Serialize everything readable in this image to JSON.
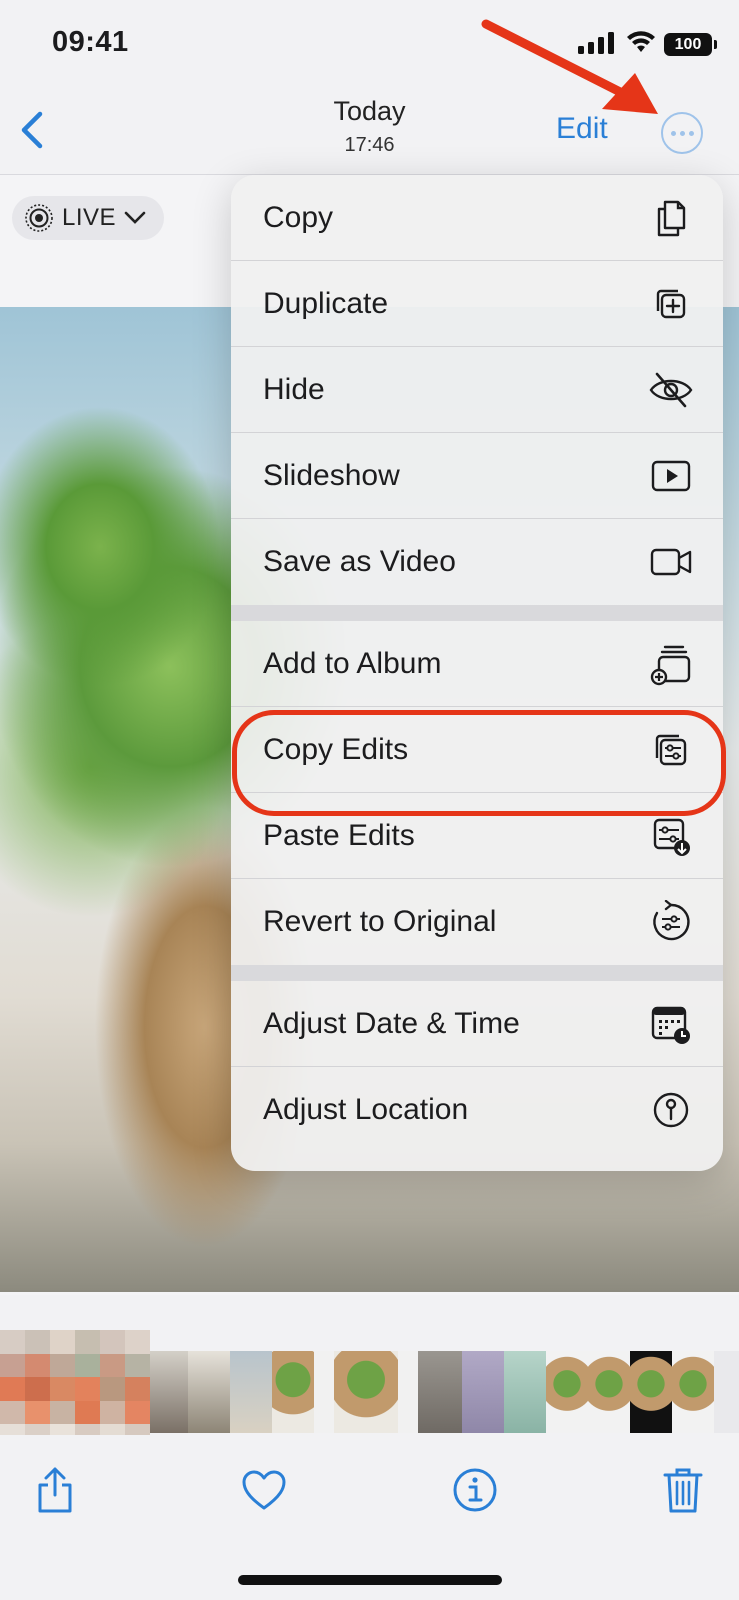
{
  "status_bar": {
    "time": "09:41",
    "battery": "100"
  },
  "nav": {
    "title": "Today",
    "subtitle": "17:46",
    "edit_label": "Edit"
  },
  "live_badge": {
    "label": "LIVE"
  },
  "menu": {
    "items": [
      {
        "label": "Copy",
        "icon": "copy-icon"
      },
      {
        "label": "Duplicate",
        "icon": "duplicate-icon"
      },
      {
        "label": "Hide",
        "icon": "eye-slash-icon"
      },
      {
        "label": "Slideshow",
        "icon": "play-rectangle-icon"
      },
      {
        "label": "Save as Video",
        "icon": "video-icon"
      },
      {
        "label": "Add to Album",
        "icon": "add-to-album-icon"
      },
      {
        "label": "Copy Edits",
        "icon": "copy-edits-icon",
        "highlighted": true
      },
      {
        "label": "Paste Edits",
        "icon": "paste-edits-icon"
      },
      {
        "label": "Revert to Original",
        "icon": "revert-icon"
      },
      {
        "label": "Adjust Date & Time",
        "icon": "calendar-clock-icon"
      },
      {
        "label": "Adjust Location",
        "icon": "location-pin-icon"
      }
    ]
  },
  "toolbar": {
    "share": "share-icon",
    "favorite": "heart-icon",
    "info": "info-icon",
    "delete": "trash-icon"
  },
  "colors": {
    "accent": "#2a7fd6",
    "annotation": "#e53518"
  }
}
